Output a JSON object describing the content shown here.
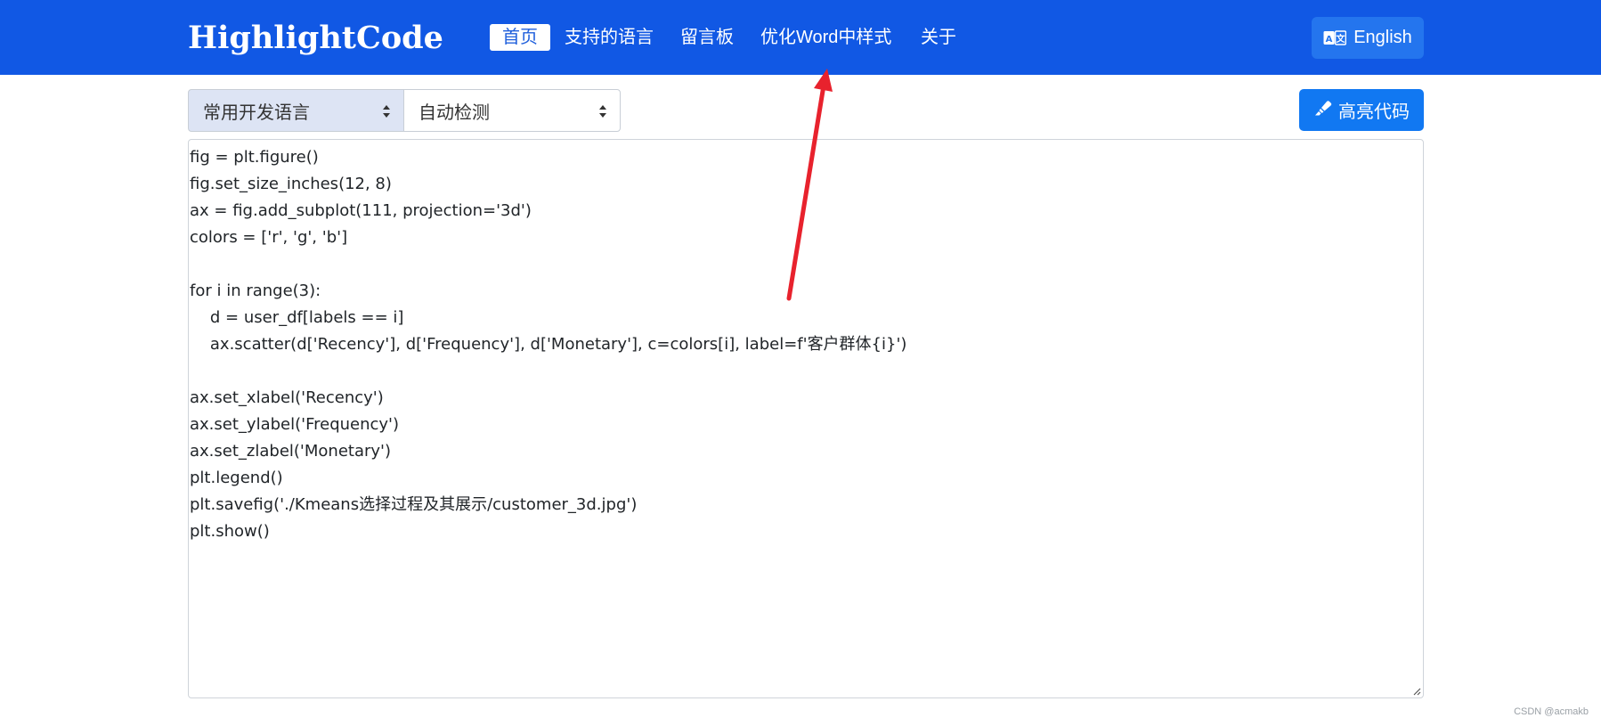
{
  "navbar": {
    "brand": "HighlightCode",
    "items": [
      {
        "label": "首页",
        "active": true
      },
      {
        "label": "支持的语言",
        "active": false
      },
      {
        "label": "留言板",
        "active": false
      },
      {
        "label": "优化Word中样式",
        "active": false
      },
      {
        "label": "关于",
        "active": false
      }
    ],
    "language_button": {
      "label": "English",
      "icon": "translate-icon"
    }
  },
  "toolbar": {
    "language_group_select": {
      "selected": "常用开发语言"
    },
    "language_select": {
      "selected": "自动检测"
    },
    "highlight_button": {
      "label": "高亮代码",
      "icon": "highlighter-icon"
    }
  },
  "editor": {
    "code": "fig = plt.figure()\nfig.set_size_inches(12, 8)\nax = fig.add_subplot(111, projection='3d')\ncolors = ['r', 'g', 'b']\n\nfor i in range(3):\n    d = user_df[labels == i]\n    ax.scatter(d['Recency'], d['Frequency'], d['Monetary'], c=colors[i], label=f'客户群体{i}')\n\nax.set_xlabel('Recency')\nax.set_ylabel('Frequency')\nax.set_zlabel('Monetary')\nplt.legend()\nplt.savefig('./Kmeans选择过程及其展示/customer_3d.jpg')\nplt.show()"
  },
  "annotation": {
    "type": "red-arrow",
    "color": "#e8222d"
  },
  "watermark": "CSDN @acmakb",
  "colors": {
    "navbar": "#1158e4",
    "primary_button": "#1178f2",
    "language_button": "#2475ee",
    "arrow": "#e8222d"
  }
}
